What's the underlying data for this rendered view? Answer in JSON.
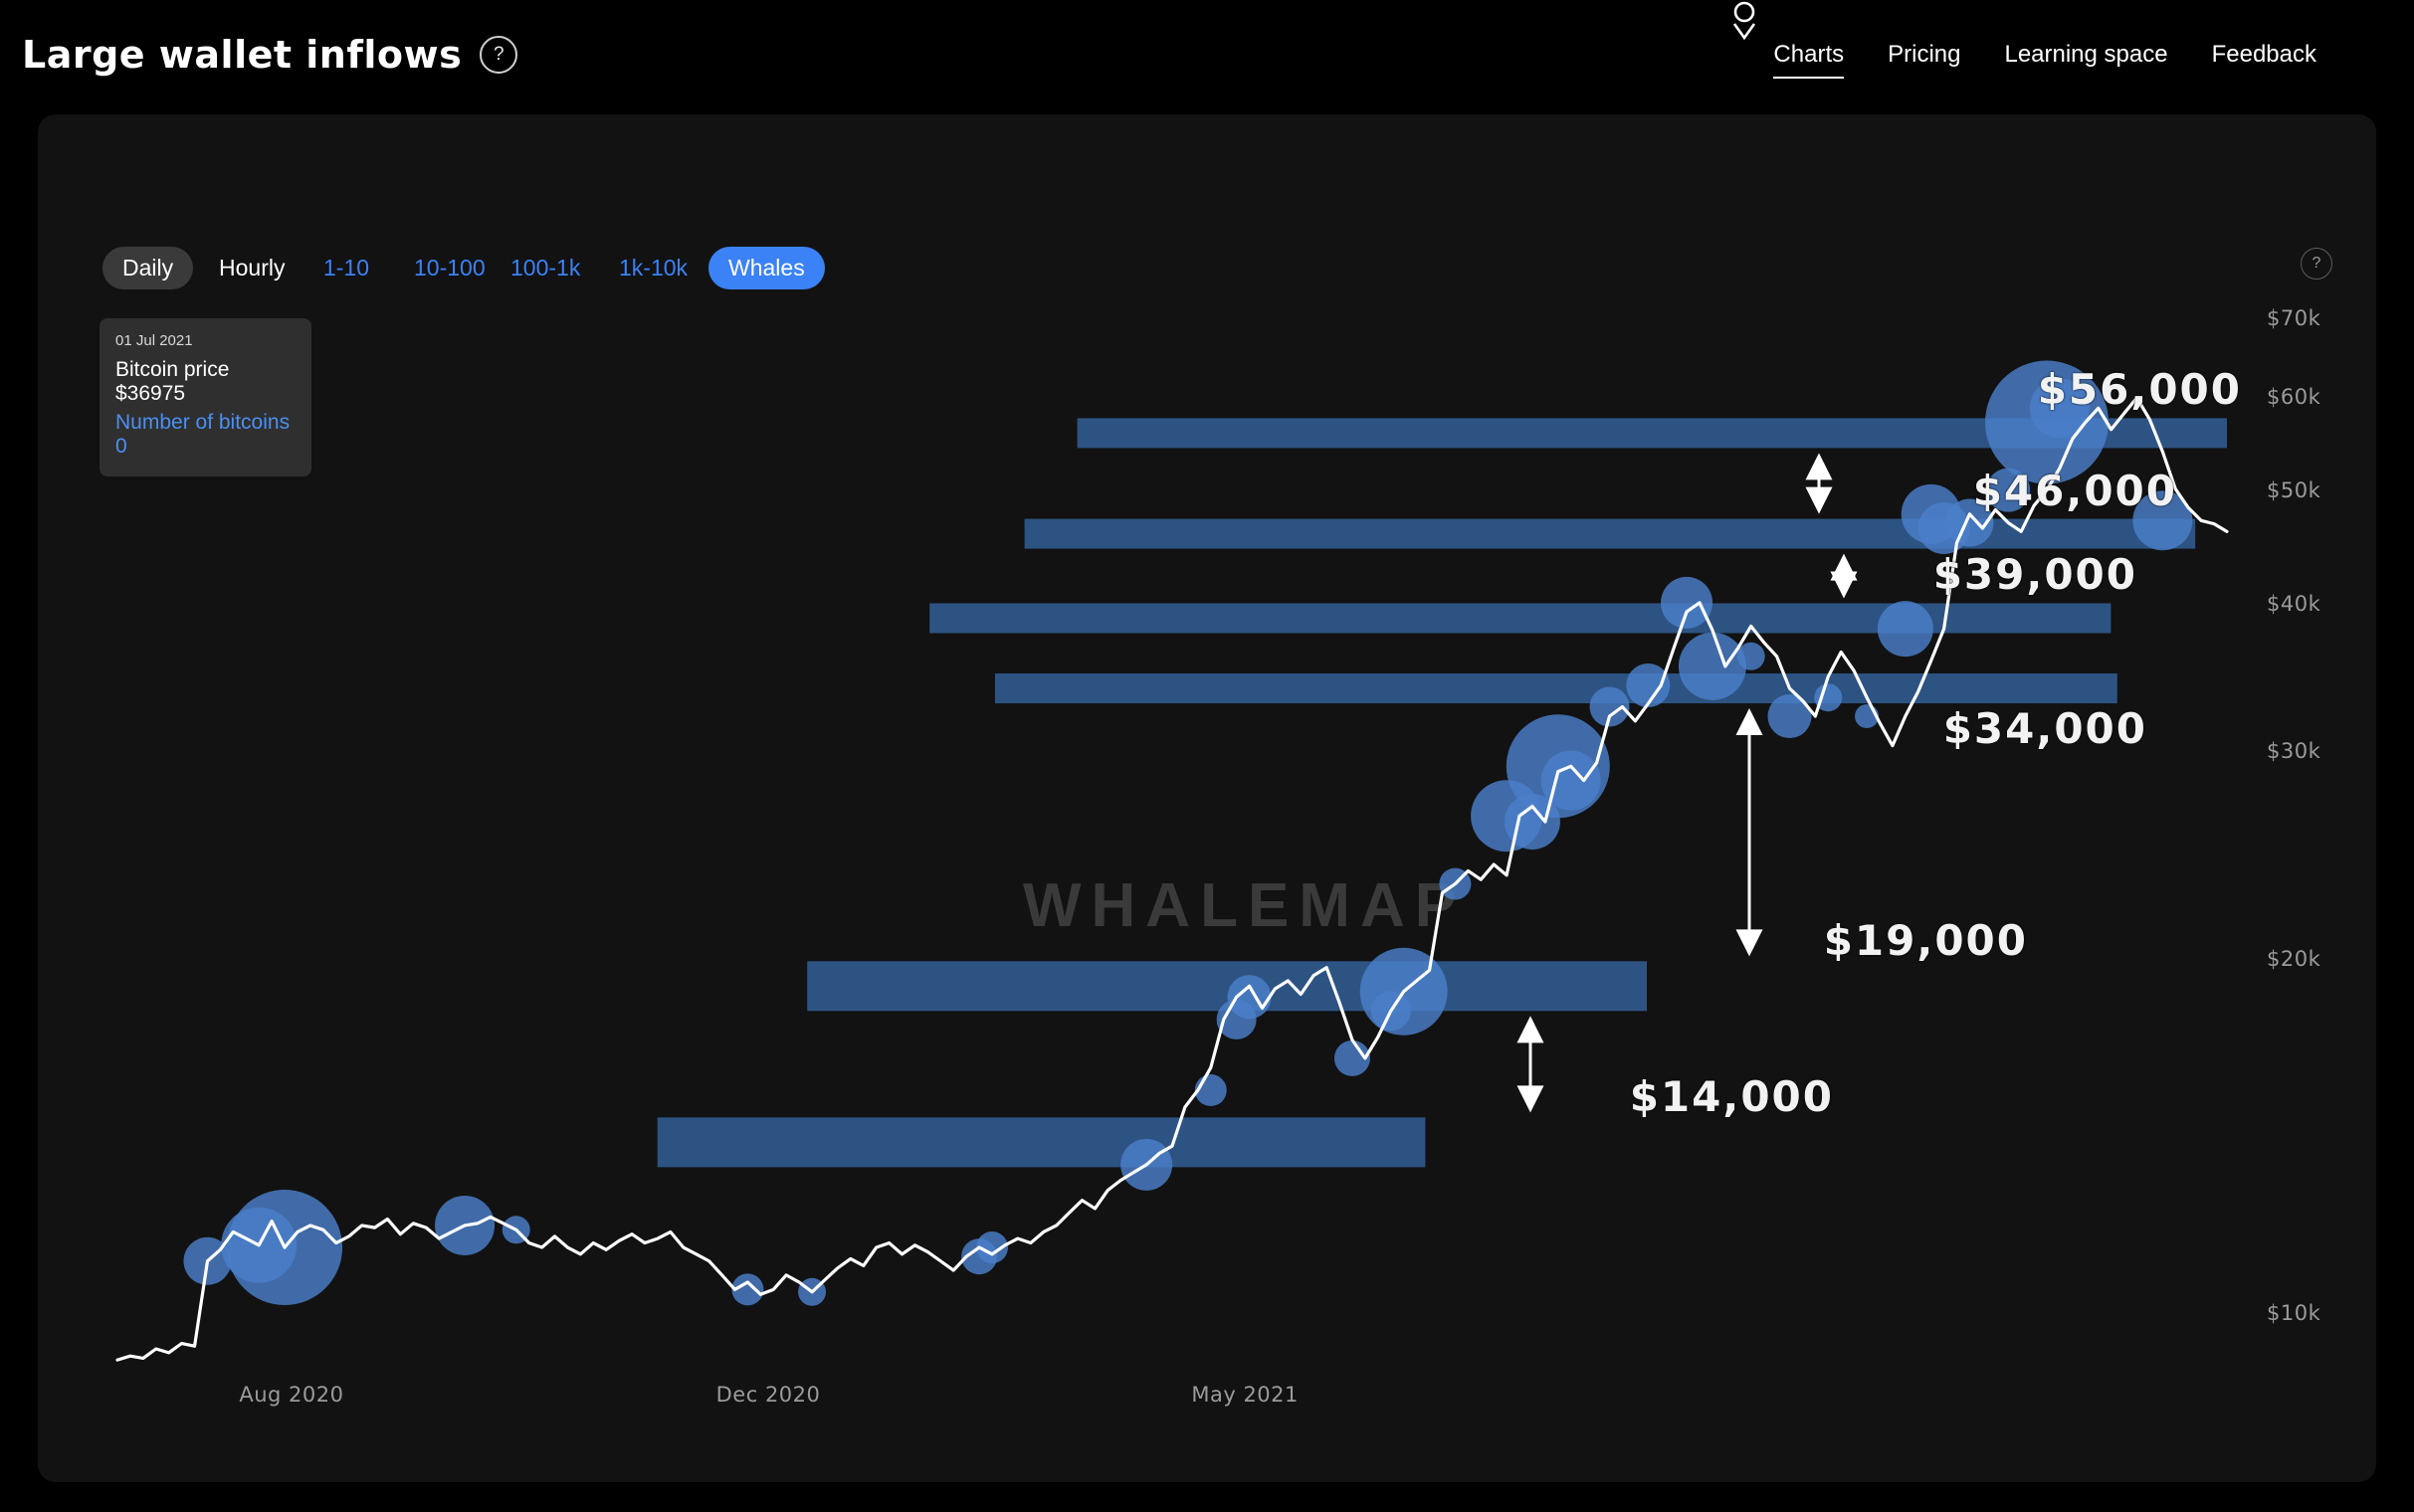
{
  "header": {
    "title": "Large wallet inflows",
    "help_icon": "question-mark-icon",
    "nav": [
      {
        "label": "Charts",
        "active": true
      },
      {
        "label": "Pricing",
        "active": false
      },
      {
        "label": "Learning space",
        "active": false
      },
      {
        "label": "Feedback",
        "active": false
      }
    ],
    "account_icon": "account-pin-icon"
  },
  "toolbar": {
    "interval": [
      {
        "label": "Daily",
        "state": "selected"
      },
      {
        "label": "Hourly",
        "state": "plain"
      }
    ],
    "cohorts": [
      {
        "label": "1-10",
        "state": "link"
      },
      {
        "label": "10-100",
        "state": "link"
      },
      {
        "label": "100-1k",
        "state": "link"
      },
      {
        "label": "1k-10k",
        "state": "link"
      },
      {
        "label": "Whales",
        "state": "selected"
      }
    ],
    "panel_help_icon": "question-mark-icon"
  },
  "tooltip": {
    "date": "01 Jul 2021",
    "price_line": "Bitcoin price $36975",
    "bitcoins_line": "Number of bitcoins 0"
  },
  "watermark": "WHALEMAP",
  "colors": {
    "accent_blue": "#3b82f6",
    "bar_blue": "#2d5383",
    "bubble_blue": "#4a7fc9",
    "price_line": "#ffffff",
    "panel_bg": "#121212",
    "page_bg": "#000000",
    "axis_text": "#9b9b9b"
  },
  "chart_data": {
    "type": "line",
    "title": "Large wallet inflows",
    "xlabel": "",
    "ylabel": "",
    "yscale": "log",
    "ylim": [
      8500,
      78000
    ],
    "grid": false,
    "legend": "none",
    "y_ticks": [
      "$10k",
      "$20k",
      "$30k",
      "$40k",
      "$50k",
      "$60k",
      "$70k"
    ],
    "y_tick_values": [
      10000,
      20000,
      30000,
      40000,
      50000,
      60000,
      70000
    ],
    "x_ticks": [
      "Aug 2020",
      "Dec 2020",
      "May 2021"
    ],
    "series": [
      {
        "name": "Bitcoin price",
        "color": "#ffffff",
        "values": [
          9150,
          9220,
          9180,
          9350,
          9280,
          9450,
          9400,
          11100,
          11350,
          11750,
          11600,
          11450,
          12000,
          11400,
          11750,
          11900,
          11800,
          11500,
          11650,
          11900,
          11850,
          12050,
          11700,
          11950,
          11850,
          11600,
          11750,
          11900,
          11950,
          12100,
          11950,
          11800,
          11500,
          11400,
          11650,
          11400,
          11250,
          11500,
          11350,
          11550,
          11700,
          11500,
          11600,
          11750,
          11400,
          11250,
          11100,
          10800,
          10500,
          10650,
          10400,
          10500,
          10800,
          10650,
          10450,
          10700,
          10950,
          11150,
          11000,
          11400,
          11500,
          11250,
          11450,
          11300,
          11100,
          10900,
          11200,
          11400,
          11250,
          11450,
          11600,
          11500,
          11750,
          11900,
          12200,
          12500,
          12300,
          12750,
          13000,
          13200,
          13400,
          13700,
          13900,
          15000,
          15500,
          16200,
          17800,
          18600,
          19000,
          18200,
          18900,
          19200,
          18700,
          19400,
          19700,
          18400,
          17100,
          16500,
          17200,
          18100,
          18800,
          19200,
          19600,
          22800,
          23200,
          23800,
          23400,
          24100,
          23600,
          26500,
          27000,
          26200,
          28900,
          29200,
          28400,
          29400,
          32200,
          32800,
          31900,
          33000,
          34200,
          36800,
          39500,
          40200,
          38100,
          35500,
          36800,
          38400,
          37200,
          36200,
          34000,
          33200,
          32200,
          34800,
          36500,
          35200,
          33400,
          31800,
          30400,
          32200,
          33800,
          35900,
          38200,
          45200,
          47800,
          46500,
          48200,
          47000,
          46200,
          48600,
          50100,
          52300,
          55400,
          57200,
          58800,
          56400,
          58200,
          60000,
          57500,
          54000,
          50200,
          48400,
          47200,
          46900,
          46200
        ]
      }
    ],
    "bubbles": [
      {
        "index": 7,
        "price": 11100,
        "size": 24
      },
      {
        "index": 11,
        "price": 11450,
        "size": 38
      },
      {
        "index": 13,
        "price": 11400,
        "size": 58
      },
      {
        "index": 27,
        "price": 11900,
        "size": 30
      },
      {
        "index": 31,
        "price": 11800,
        "size": 14
      },
      {
        "index": 49,
        "price": 10500,
        "size": 16
      },
      {
        "index": 54,
        "price": 10450,
        "size": 14
      },
      {
        "index": 67,
        "price": 11200,
        "size": 18
      },
      {
        "index": 68,
        "price": 11400,
        "size": 16
      },
      {
        "index": 80,
        "price": 13400,
        "size": 26
      },
      {
        "index": 85,
        "price": 15500,
        "size": 16
      },
      {
        "index": 87,
        "price": 17800,
        "size": 20
      },
      {
        "index": 88,
        "price": 18600,
        "size": 22
      },
      {
        "index": 96,
        "price": 16500,
        "size": 18
      },
      {
        "index": 99,
        "price": 18100,
        "size": 20
      },
      {
        "index": 100,
        "price": 18800,
        "size": 44
      },
      {
        "index": 104,
        "price": 23200,
        "size": 16
      },
      {
        "index": 108,
        "price": 26500,
        "size": 36
      },
      {
        "index": 110,
        "price": 26200,
        "size": 28
      },
      {
        "index": 112,
        "price": 29200,
        "size": 52
      },
      {
        "index": 113,
        "price": 28400,
        "size": 30
      },
      {
        "index": 116,
        "price": 32800,
        "size": 20
      },
      {
        "index": 119,
        "price": 34200,
        "size": 22
      },
      {
        "index": 122,
        "price": 40200,
        "size": 26
      },
      {
        "index": 124,
        "price": 35500,
        "size": 34
      },
      {
        "index": 127,
        "price": 36200,
        "size": 14
      },
      {
        "index": 130,
        "price": 32200,
        "size": 22
      },
      {
        "index": 133,
        "price": 33400,
        "size": 14
      },
      {
        "index": 136,
        "price": 32200,
        "size": 12
      },
      {
        "index": 139,
        "price": 38200,
        "size": 28
      },
      {
        "index": 141,
        "price": 47800,
        "size": 30
      },
      {
        "index": 142,
        "price": 46500,
        "size": 26
      },
      {
        "index": 144,
        "price": 47000,
        "size": 24
      },
      {
        "index": 147,
        "price": 50100,
        "size": 22
      },
      {
        "index": 150,
        "price": 57200,
        "size": 62
      },
      {
        "index": 151,
        "price": 58800,
        "size": 30
      },
      {
        "index": 159,
        "price": 47200,
        "size": 30
      }
    ],
    "support_levels": [
      {
        "label": "$56,000",
        "value": 56000,
        "x_start_frac": 0.455,
        "x_end_frac": 1.0,
        "thickness": 30
      },
      {
        "label": "$46,000",
        "value": 46000,
        "x_start_frac": 0.43,
        "x_end_frac": 0.985,
        "thickness": 30
      },
      {
        "label": "$39,000",
        "value": 39000,
        "x_start_frac": 0.385,
        "x_end_frac": 0.945,
        "thickness": 30
      },
      {
        "label": "$34,000",
        "value": 34000,
        "x_start_frac": 0.416,
        "x_end_frac": 0.948,
        "thickness": 30
      },
      {
        "label": "$19,000",
        "value": 19000,
        "x_start_frac": 0.327,
        "x_end_frac": 0.725,
        "thickness": 50
      },
      {
        "label": "$14,000",
        "value": 14000,
        "x_start_frac": 0.256,
        "x_end_frac": 0.62,
        "thickness": 50
      }
    ],
    "gap_arrows": [
      {
        "from": "$56,000",
        "to": "$46,000",
        "direction": "both"
      },
      {
        "from": "$46,000",
        "to": "$39,000",
        "direction": "both"
      },
      {
        "from": "$34,000",
        "to": "$19,000",
        "direction": "both"
      },
      {
        "from": "$19,000",
        "to": "$14,000",
        "direction": "both"
      }
    ]
  }
}
